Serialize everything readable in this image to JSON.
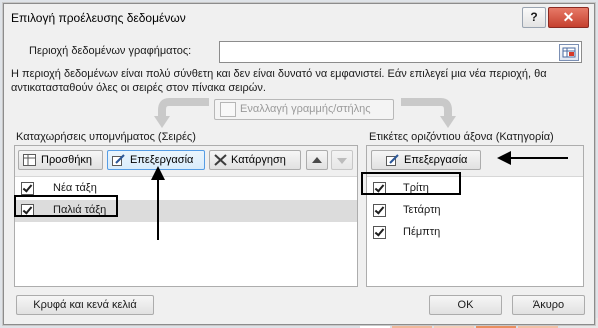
{
  "dialog": {
    "title": "Επιλογή προέλευσης δεδομένων",
    "help_glyph": "?",
    "close_glyph": "✕",
    "range_label": "Περιοχή δεδομένων γραφήματος:",
    "range_value": "",
    "message_line1": "Η περιοχή δεδομένων είναι πολύ σύνθετη και δεν είναι δυνατό να εμφανιστεί. Εάν επιλεγεί μια νέα περιοχή, θα",
    "message_line2": "αντικατασταθούν όλες οι σειρές στον πίνακα σειρών.",
    "switch_label": "Εναλλαγή γραμμής/στήλης"
  },
  "series": {
    "heading": "Καταχωρήσεις υπομνήματος (Σειρές)",
    "add_label": "Προσθήκη",
    "edit_label": "Επεξεργασία",
    "remove_label": "Κατάργηση",
    "items": [
      {
        "label": "Νέα τάξη",
        "checked": true
      },
      {
        "label": "Παλιά τάξη",
        "checked": true
      }
    ]
  },
  "categories": {
    "heading": "Ετικέτες οριζόντιου άξονα (Κατηγορία)",
    "edit_label": "Επεξεργασία",
    "items": [
      {
        "label": "Τρίτη",
        "checked": true
      },
      {
        "label": "Τετάρτη",
        "checked": true
      },
      {
        "label": "Πέμπτη",
        "checked": true
      }
    ]
  },
  "footer": {
    "hidden_empty_label": "Κρυφά και κενά κελιά",
    "ok_label": "ΟΚ",
    "cancel_label": "Άκυρο"
  },
  "colors": {
    "accent_border": "#569de5",
    "close_button": "#c5402e",
    "selected_row": "#dcdcdc"
  }
}
